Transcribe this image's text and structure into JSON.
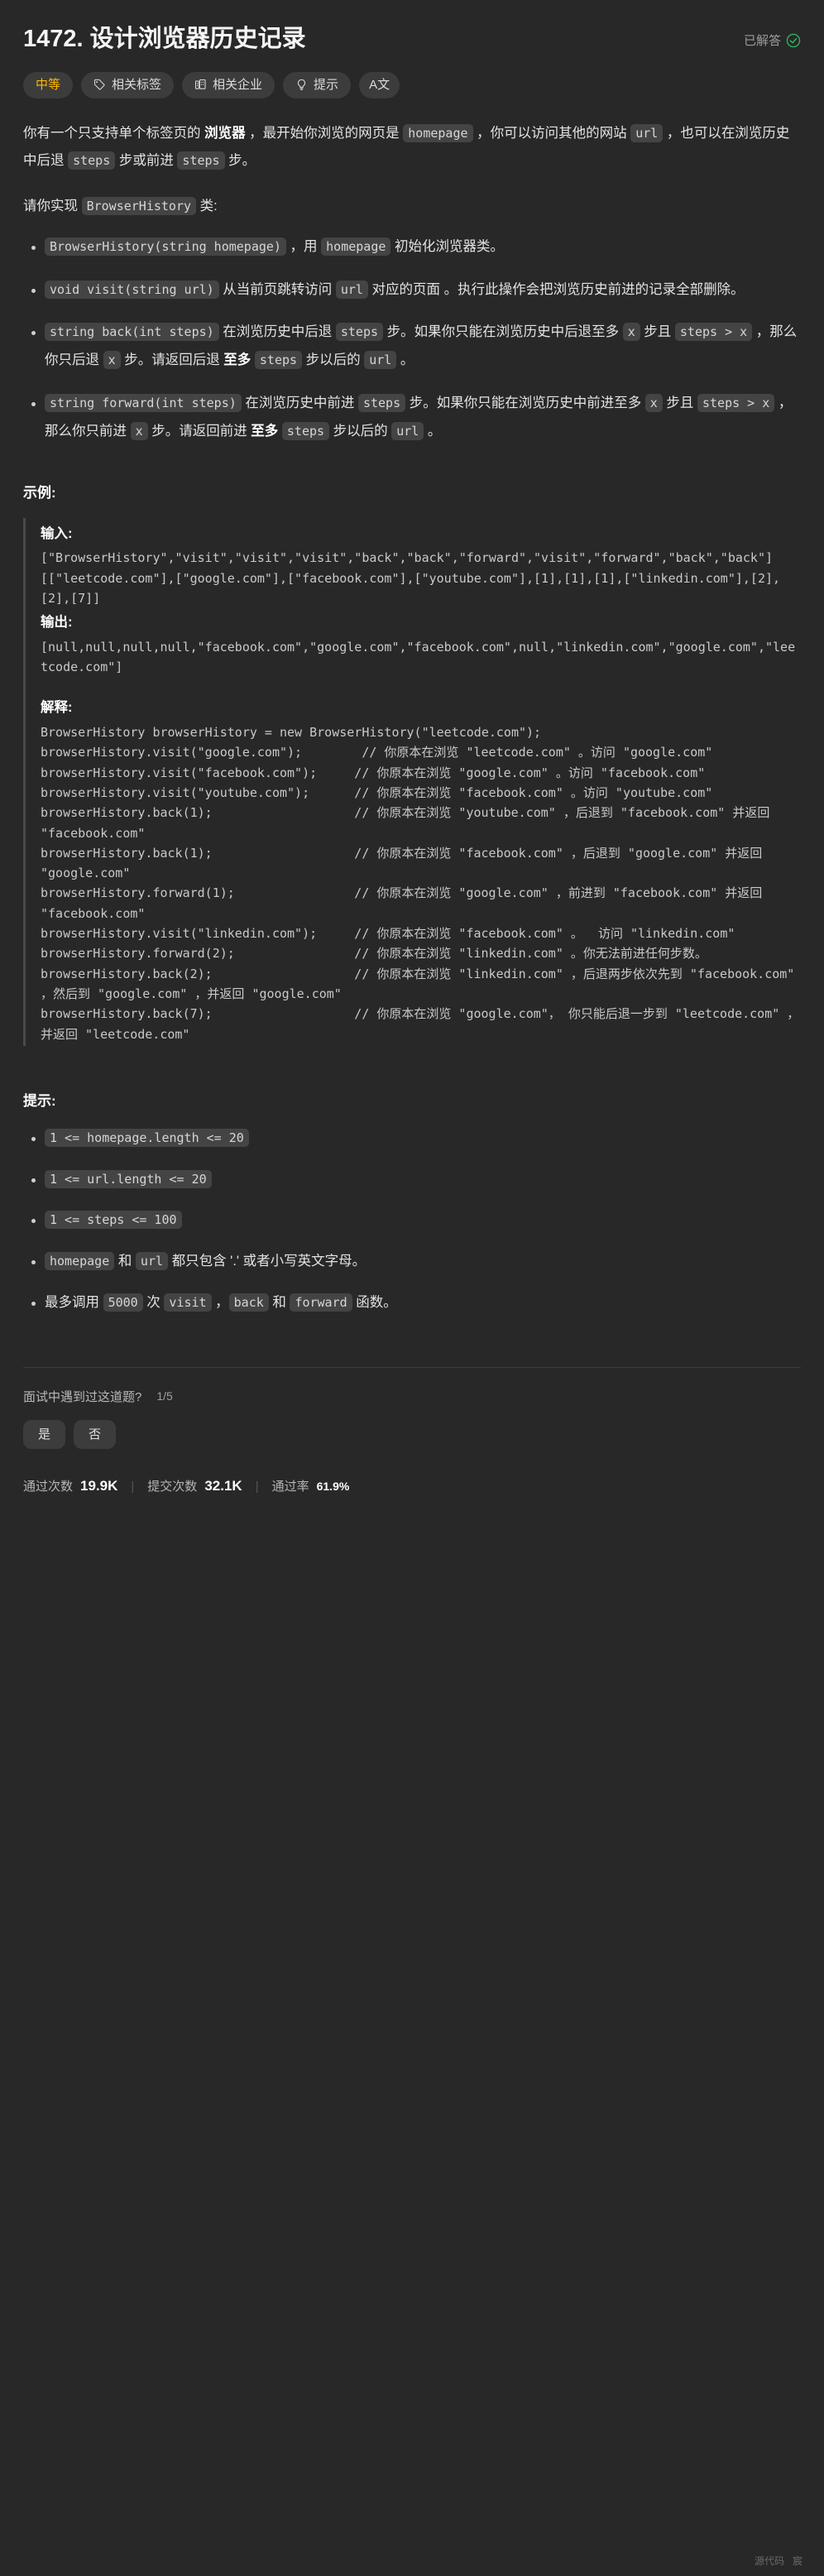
{
  "header": {
    "title": "1472. 设计浏览器历史记录",
    "solved_label": "已解答",
    "check_icon": "check-circle-icon",
    "accent_solved": "#2db55d"
  },
  "tags": [
    {
      "label": "中等",
      "icon": null,
      "name": "difficulty"
    },
    {
      "label": "相关标签",
      "icon": "tag-icon",
      "name": "related-tags"
    },
    {
      "label": "相关企业",
      "icon": "building-icon",
      "name": "related-companies"
    },
    {
      "label": "提示",
      "icon": "lightbulb-icon",
      "name": "hint"
    },
    {
      "label": "A文",
      "icon": "translate-icon",
      "name": "translate"
    }
  ],
  "description": {
    "p1_a": "你有一个只支持单个标签页的 ",
    "p1_bold": "浏览器",
    "p1_b": " ，最开始你浏览的网页是 ",
    "p1_code1": "homepage",
    "p1_c": " ，你可以访问其他的网站 ",
    "p1_code2": "url",
    "p1_d": " ，也可以在浏览历史中后退 ",
    "p1_code3": "steps",
    "p1_e": " 步或前进 ",
    "p1_code4": "steps",
    "p1_f": " 步。",
    "p2_a": "请你实现 ",
    "p2_code": "BrowserHistory",
    "p2_b": " 类:"
  },
  "methods": [
    {
      "code1": "BrowserHistory(string homepage)",
      "t1": " ，用 ",
      "code2": "homepage",
      "t2": " 初始化浏览器类。"
    },
    {
      "code1": "void visit(string url)",
      "t1": " 从当前页跳转访问 ",
      "code2": "url",
      "t2": " 对应的页面 。执行此操作会把浏览历史前进的记录全部删除。"
    },
    {
      "code1": "string back(int steps)",
      "t1": " 在浏览历史中后退 ",
      "code2": "steps",
      "t2": " 步。如果你只能在浏览历史中后退至多 ",
      "code3": "x",
      "t3": " 步且 ",
      "code4": "steps > x",
      "t4": " ，那么你只后退 ",
      "code5": "x",
      "t5": " 步。请返回后退 ",
      "bold": "至多",
      "t6": " ",
      "code6": "steps",
      "t7": " 步以后的 ",
      "code7": "url",
      "t8": " 。"
    },
    {
      "code1": "string forward(int steps)",
      "t1": " 在浏览历史中前进 ",
      "code2": "steps",
      "t2": " 步。如果你只能在浏览历史中前进至多 ",
      "code3": "x",
      "t3": " 步且 ",
      "code4": "steps > x",
      "t4": " ，那么你只前进 ",
      "code5": "x",
      "t5": " 步。请返回前进 ",
      "bold": "至多",
      "t6": " ",
      "code6": "steps",
      "t7": " 步以后的 ",
      "code7": "url",
      "t8": " 。"
    }
  ],
  "example": {
    "section_title": "示例:",
    "input_label": "输入:",
    "input_text": "[\"BrowserHistory\",\"visit\",\"visit\",\"visit\",\"back\",\"back\",\"forward\",\"visit\",\"forward\",\"back\",\"back\"]\n[[\"leetcode.com\"],[\"google.com\"],[\"facebook.com\"],[\"youtube.com\"],[1],[1],[1],[\"linkedin.com\"],[2],[2],[7]]",
    "output_label": "输出:",
    "output_text": "[null,null,null,null,\"facebook.com\",\"google.com\",\"facebook.com\",null,\"linkedin.com\",\"google.com\",\"leetcode.com\"]",
    "explain_label": "解释:",
    "explain_text": "BrowserHistory browserHistory = new BrowserHistory(\"leetcode.com\");\nbrowserHistory.visit(\"google.com\");        // 你原本在浏览 \"leetcode.com\" 。访问 \"google.com\"\nbrowserHistory.visit(\"facebook.com\");     // 你原本在浏览 \"google.com\" 。访问 \"facebook.com\"\nbrowserHistory.visit(\"youtube.com\");      // 你原本在浏览 \"facebook.com\" 。访问 \"youtube.com\"\nbrowserHistory.back(1);                   // 你原本在浏览 \"youtube.com\" ，后退到 \"facebook.com\" 并返回 \"facebook.com\"\nbrowserHistory.back(1);                   // 你原本在浏览 \"facebook.com\" ，后退到 \"google.com\" 并返回 \"google.com\"\nbrowserHistory.forward(1);                // 你原本在浏览 \"google.com\" ，前进到 \"facebook.com\" 并返回 \"facebook.com\"\nbrowserHistory.visit(\"linkedin.com\");     // 你原本在浏览 \"facebook.com\" 。  访问 \"linkedin.com\"\nbrowserHistory.forward(2);                // 你原本在浏览 \"linkedin.com\" 。你无法前进任何步数。\nbrowserHistory.back(2);                   // 你原本在浏览 \"linkedin.com\" ，后退两步依次先到 \"facebook.com\" ，然后到 \"google.com\" ，并返回 \"google.com\"\nbrowserHistory.back(7);                   // 你原本在浏览 \"google.com\"， 你只能后退一步到 \"leetcode.com\" ，并返回 \"leetcode.com\""
  },
  "hints": {
    "title": "提示:",
    "items": [
      {
        "code1": "1 <= homepage.length <= 20"
      },
      {
        "code1": "1 <= url.length <= 20"
      },
      {
        "code1": "1 <= steps <= 100"
      },
      {
        "code1": "homepage",
        "t1": " 和 ",
        "code2": "url",
        "t2": " 都只包含 '.' 或者小写英文字母。"
      },
      {
        "t0": "最多调用 ",
        "code1": "5000",
        "t1": " 次 ",
        "code2": "visit",
        "t2": " ，",
        "code3": "back",
        "t3": " 和 ",
        "code4": "forward",
        "t4": " 函数。"
      }
    ]
  },
  "footer": {
    "interview_question": "面试中遇到过这道题?",
    "interview_count": "1/5",
    "yes_label": "是",
    "no_label": "否",
    "stats": [
      {
        "label": "通过次数",
        "value": "19.9K"
      },
      {
        "label": "提交次数",
        "value": "32.1K"
      },
      {
        "label": "通过率",
        "value": "61.9%"
      }
    ],
    "credit_left": "源代码",
    "credit_right": "宸"
  }
}
